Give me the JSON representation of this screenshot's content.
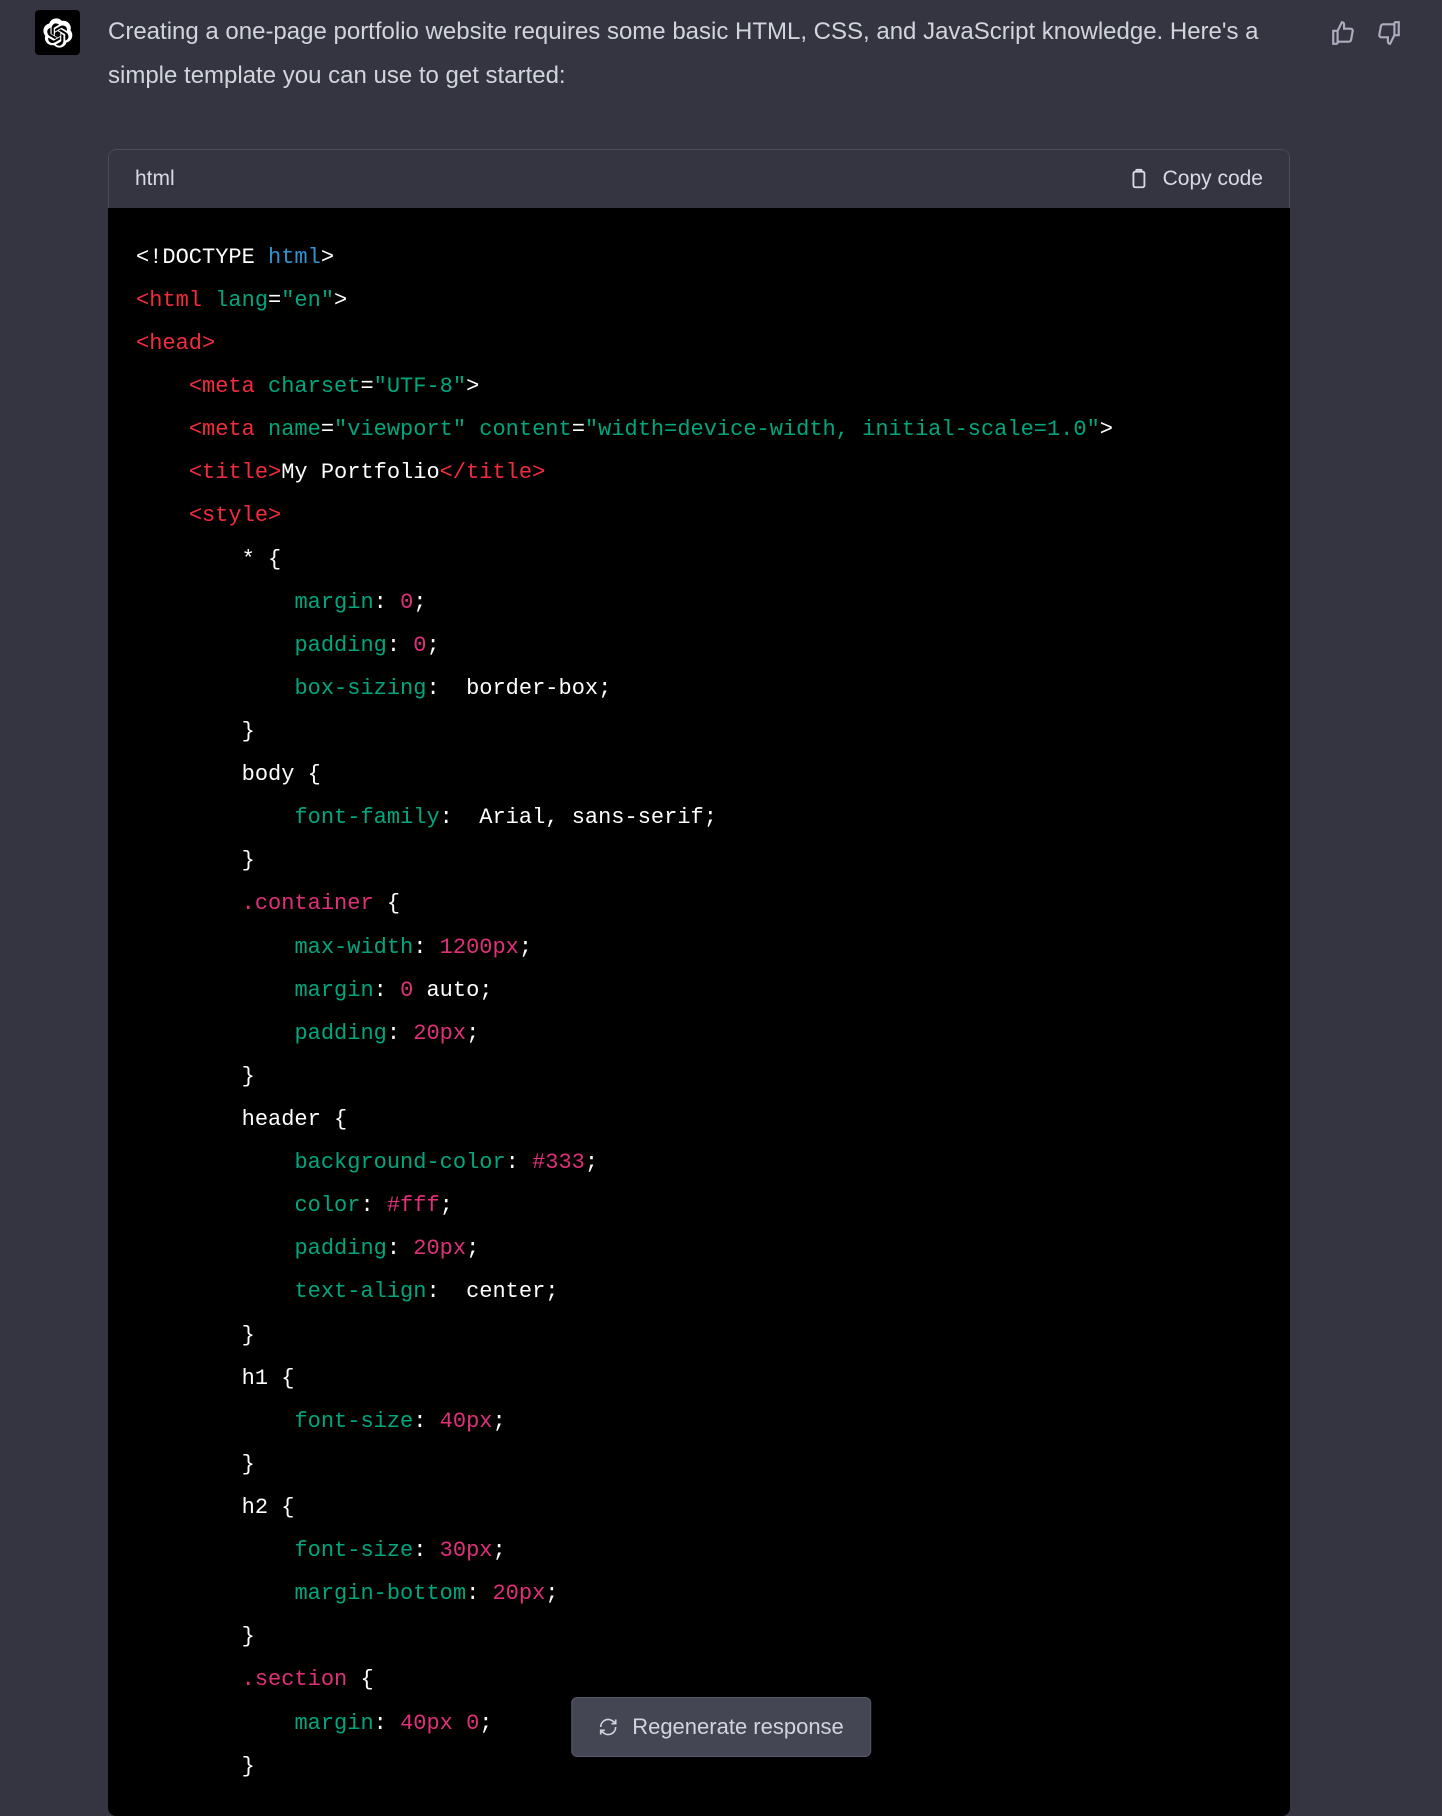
{
  "message": {
    "intro": "Creating a one-page portfolio website requires some basic HTML, CSS, and JavaScript knowledge. Here's a simple template you can use to get started:"
  },
  "code": {
    "lang_label": "html",
    "copy_label": "Copy code",
    "tokens": {
      "doctype_open": "<!DOCTYPE ",
      "doctype_html": "html",
      "gt": ">",
      "html_open": "<html ",
      "lang_attr": "lang",
      "eq": "=",
      "lang_val": "\"en\"",
      "head_open": "<head>",
      "meta_open": "<meta ",
      "charset_attr": "charset",
      "charset_val": "\"UTF-8\"",
      "name_attr": "name",
      "viewport_val": "\"viewport\"",
      "content_attr": "content",
      "content_val": "\"width=device-width, initial-scale=1.0\"",
      "title_open": "<title>",
      "title_text": "My Portfolio",
      "title_close": "</title>",
      "style_open": "<style>",
      "sel_star": "* {",
      "prop_margin": "margin",
      "colon": ": ",
      "zero": "0",
      "semi": ";",
      "prop_padding": "padding",
      "prop_boxsizing": "box-sizing",
      "val_borderbox": " border-box;",
      "brace_close": "}",
      "sel_body": "body {",
      "prop_fontfamily": "font-family",
      "val_arial": " Arial, sans-serif;",
      "sel_container": ".container",
      "brace_open": " {",
      "prop_maxwidth": "max-width",
      "val_1200": "1200px",
      "val_auto": " auto;",
      "val_20px": "20px",
      "sel_header": "header {",
      "prop_bgcolor": "background-color",
      "val_333": "#333",
      "prop_color": "color",
      "val_fff": "#fff",
      "prop_textalign": "text-align",
      "val_center": " center;",
      "sel_h1": "h1 {",
      "prop_fontsize": "font-size",
      "val_40px": "40px",
      "sel_h2": "h2 {",
      "val_30px": "30px",
      "prop_marginbottom": "margin-bottom",
      "sel_section": ".section",
      "val_40px_0": "40px"
    }
  },
  "actions": {
    "regenerate": "Regenerate response"
  }
}
